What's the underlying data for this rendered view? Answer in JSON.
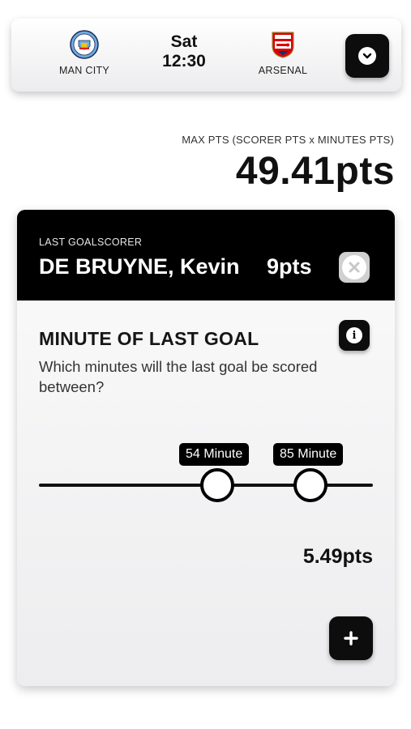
{
  "match": {
    "home_team": "MAN CITY",
    "away_team": "ARSENAL",
    "day": "Sat",
    "time": "12:30"
  },
  "max_points": {
    "label": "MAX PTS (SCORER PTS x MINUTES PTS)",
    "value": "49.41pts"
  },
  "scorer": {
    "label": "LAST GOALSCORER",
    "name": "DE BRUYNE, Kevin",
    "points": "9pts"
  },
  "minute_question": {
    "title": "MINUTE OF LAST GOAL",
    "question": "Which minutes will the last goal be scored between?",
    "low_label": "54 Minute",
    "high_label": "85 Minute",
    "points": "5.49pts"
  },
  "icons": {
    "dropdown": "chevron-down-icon",
    "close": "close-icon",
    "info": "info-icon",
    "add": "plus-icon"
  },
  "colors": {
    "accent": "#000000",
    "arsenal_red": "#db0007",
    "city_blue": "#6cabdd"
  }
}
